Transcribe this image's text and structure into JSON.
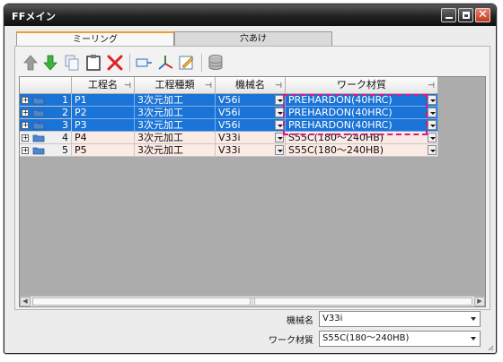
{
  "window": {
    "title": "FFメイン"
  },
  "tabs": [
    {
      "label": "ミーリング",
      "active": true
    },
    {
      "label": "穴あけ",
      "active": false
    }
  ],
  "toolbar": {
    "icons": [
      "arrow-up-icon",
      "arrow-down-icon",
      "copy-icon",
      "paste-icon",
      "delete-icon",
      "insert-icon",
      "axis-icon",
      "edit-icon",
      "database-icon"
    ]
  },
  "grid": {
    "columns": [
      {
        "label": "工程名"
      },
      {
        "label": "工程種類"
      },
      {
        "label": "機械名"
      },
      {
        "label": "ワーク材質"
      }
    ],
    "rows": [
      {
        "num": "1",
        "name": "P1",
        "type": "3次元加工",
        "machine": "V56i",
        "material": "PREHARDON(40HRC)",
        "selected": true
      },
      {
        "num": "2",
        "name": "P2",
        "type": "3次元加工",
        "machine": "V56i",
        "material": "PREHARDON(40HRC)",
        "selected": true
      },
      {
        "num": "3",
        "name": "P3",
        "type": "3次元加工",
        "machine": "V56i",
        "material": "PREHARDON(40HRC)",
        "selected": true
      },
      {
        "num": "4",
        "name": "P4",
        "type": "3次元加工",
        "machine": "V33i",
        "material": "S55C(180～240HB)",
        "selected": false
      },
      {
        "num": "5",
        "name": "P5",
        "type": "3次元加工",
        "machine": "V33i",
        "material": "S55C(180～240HB)",
        "selected": false
      }
    ]
  },
  "form": {
    "machine": {
      "label": "機械名",
      "value": "V33i"
    },
    "material": {
      "label": "ワーク材質",
      "value": "S55C(180～240HB)"
    }
  },
  "colors": {
    "selection": "#1a73d6",
    "unselected_row": "#fcebe4",
    "highlight": "#d5198c",
    "active_tab": "#f0a030"
  }
}
